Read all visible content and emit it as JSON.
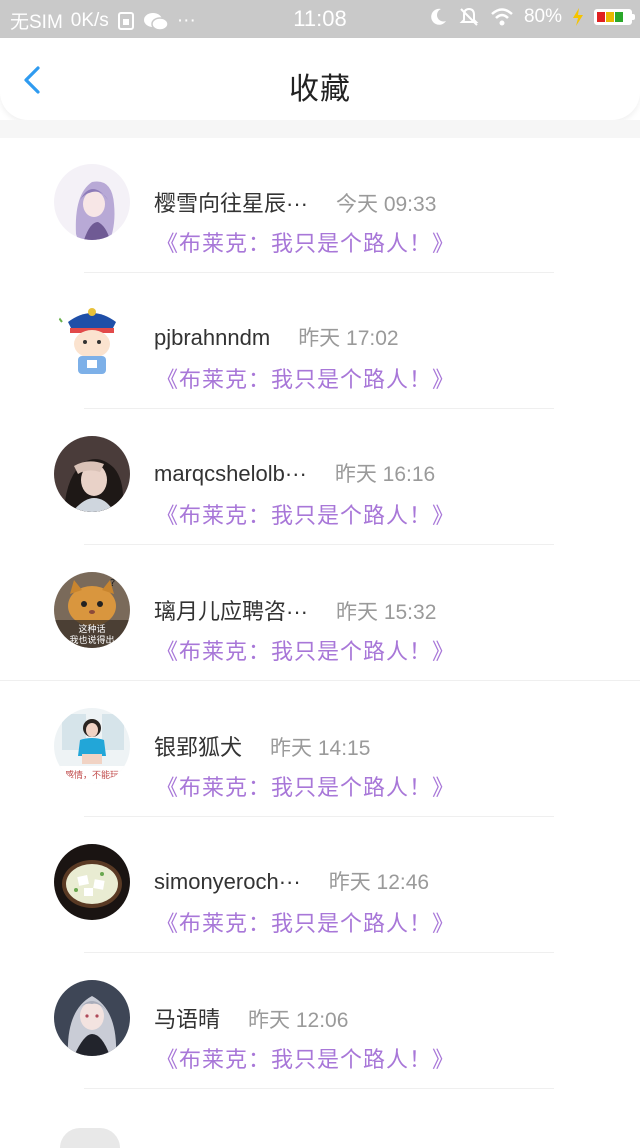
{
  "status_bar": {
    "carrier": "无SIM",
    "speed": "0K/s",
    "more": "···",
    "time": "11:08",
    "battery": "80%"
  },
  "header": {
    "title": "收藏"
  },
  "items": [
    {
      "name": "樱雪向往星辰···",
      "time": "今天 09:33",
      "message": "《布莱克：我只是个路人！》"
    },
    {
      "name": "pjbrahnndm",
      "time": "昨天 17:02",
      "message": "《布莱克：我只是个路人！》"
    },
    {
      "name": "marqcshelolb···",
      "time": "昨天 16:16",
      "message": "《布莱克：我只是个路人！》"
    },
    {
      "name": "璃月儿应聘咨···",
      "time": "昨天 15:32",
      "message": "《布莱克：我只是个路人！》",
      "avatar_text": [
        "这种话",
        "我也说得出"
      ]
    },
    {
      "name": "银郢狐犬",
      "time": "昨天 14:15",
      "message": "《布莱克：我只是个路人！》",
      "avatar_text": [
        "感情，不能玩"
      ]
    },
    {
      "name": "simonyeroch···",
      "time": "昨天 12:46",
      "message": "《布莱克：我只是个路人！》"
    },
    {
      "name": "马语晴",
      "time": "昨天 12:06",
      "message": "《布莱克：我只是个路人！》"
    }
  ],
  "colors": {
    "accent_blue": "#2f9bf0",
    "message_purple": "#a877d8",
    "status_bar_bg": "#c9c9c9"
  }
}
